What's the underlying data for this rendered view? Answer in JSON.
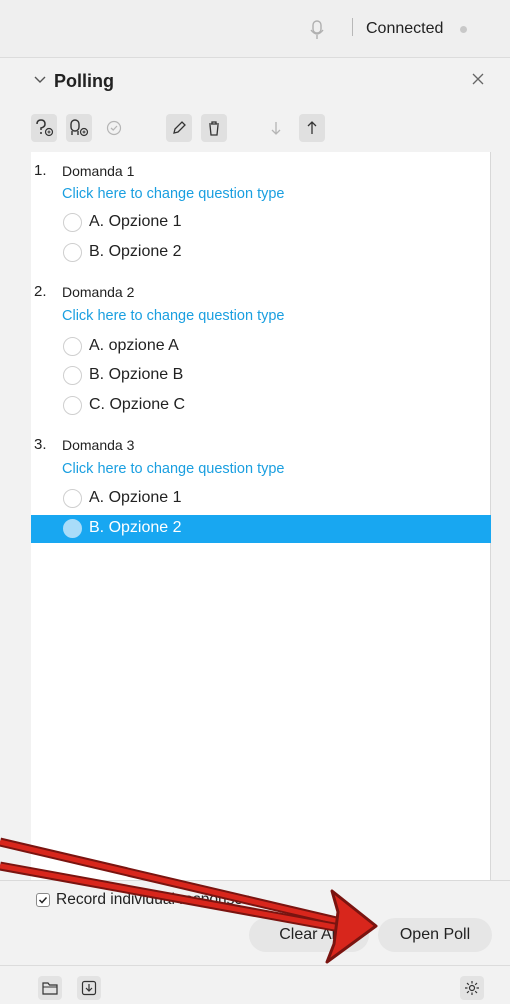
{
  "status": {
    "connection": "Connected"
  },
  "panel": {
    "title": "Polling"
  },
  "toolbar": {
    "buttons": [
      "add-question-icon",
      "add-answer-icon",
      "check-icon",
      "edit-icon",
      "delete-icon",
      "move-down-icon",
      "move-up-icon"
    ]
  },
  "questions": [
    {
      "number": "1.",
      "text": "Domanda 1",
      "type_link": "Click here to change question type",
      "options": [
        "A. Opzione 1",
        "B. Opzione 2"
      ]
    },
    {
      "number": "2.",
      "text": "Domanda 2",
      "type_link": "Click here to change question type",
      "options": [
        "A. opzione A",
        "B. Opzione B",
        "C. Opzione C"
      ]
    },
    {
      "number": "3.",
      "text": "Domanda 3",
      "type_link": "Click here to change question type",
      "options": [
        "A. Opzione 1",
        "B. Opzione 2"
      ],
      "selected_option": "B. Opzione 2"
    }
  ],
  "footer": {
    "record_label": "Record individual responses",
    "record_checked": true,
    "clear_all": "Clear All",
    "open_poll": "Open Poll"
  },
  "colors": {
    "accent": "#18a7f1",
    "link": "#1a9fe0",
    "annotation": "#d8261c"
  }
}
